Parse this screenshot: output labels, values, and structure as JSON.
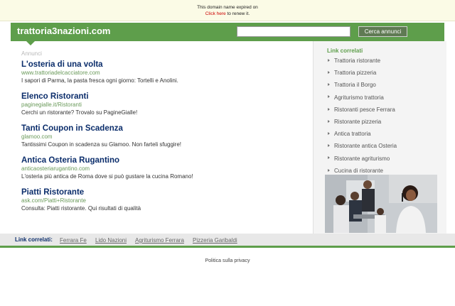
{
  "notice": {
    "line1": "This domain name expired on",
    "link": "Click here",
    "line2_suffix": " to renew it."
  },
  "header": {
    "domain": "trattoria3nazioni.com",
    "search_placeholder": "",
    "search_button": "Cerca annunci"
  },
  "main": {
    "annunci_label": "Annunci",
    "ads": [
      {
        "title": "L'osteria di una volta",
        "url": "www.trattoriadelcacciatore.com",
        "desc": "I sapori di Parma, la pasta fresca ogni giorno: Tortelli e Anolini."
      },
      {
        "title": "Elenco Ristoranti",
        "url": "paginegialle.it/Ristoranti",
        "desc": "Cerchi un ristorante? Trovalo su PagineGialle!"
      },
      {
        "title": "Tanti Coupon in Scadenza",
        "url": "glamoo.com",
        "desc": "Tantissimi Coupon in scadenza su Glamoo. Non farteli sfuggire!"
      },
      {
        "title": "Antica Osteria Rugantino",
        "url": "anticaosteriarugantino.com",
        "desc": "L'osteria più antica de Roma dove si può gustare la cucina Romano!"
      },
      {
        "title": "Piatti Ristorante",
        "url": "ask.com/Piatti+Ristorante",
        "desc": "Consulta: Piatti ristorante. Qui risultati di qualità"
      }
    ]
  },
  "sidebar": {
    "title": "Link correlati",
    "items": [
      "Trattoria ristorante",
      "Trattoria pizzeria",
      "Trattoria il Borgo",
      "Agriturismo trattoria",
      "Ristoranti pesce Ferrara",
      "Ristorante pizzeria",
      "Antica trattoria",
      "Ristorante antica Osteria",
      "Ristorante agriturismo",
      "Cucina di ristorante"
    ]
  },
  "related_bar": {
    "label": "Link correlati:",
    "links": [
      "Ferrara Fe",
      "Lido Nazioni",
      "Agriturismo Ferrara",
      "Pizzeria Garibaldi"
    ]
  },
  "footer": {
    "privacy": "Politica sulla privacy"
  },
  "colors": {
    "brand_green": "#5e9e4b",
    "title_blue": "#0b2d6b",
    "url_green": "#6a9a5a",
    "notice_link_red": "#cc0000"
  }
}
